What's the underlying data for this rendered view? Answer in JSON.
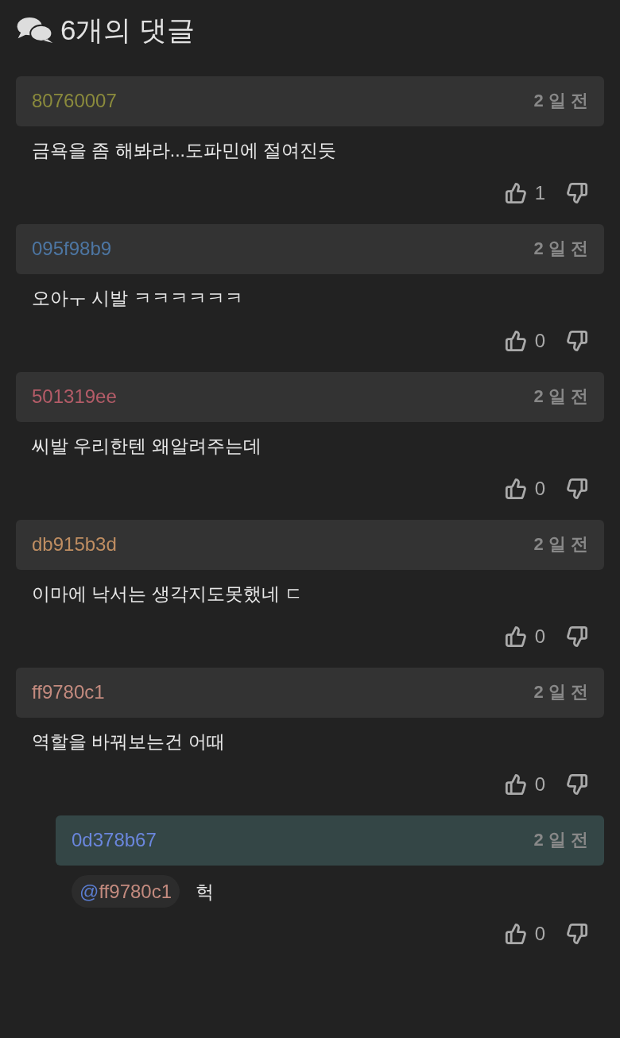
{
  "header": {
    "title": "6개의 댓글"
  },
  "comments": [
    {
      "author": "80760007",
      "color": "#8a8a3c",
      "time": "2 일 전",
      "text": "금욕을 좀 해봐라...도파민에 절여진듯",
      "likes": "1"
    },
    {
      "author": "095f98b9",
      "color": "#4d76a3",
      "time": "2 일 전",
      "text": "오아ㅜ 시발 ㅋㅋㅋㅋㅋㅋ",
      "likes": "0"
    },
    {
      "author": "501319ee",
      "color": "#b45c68",
      "time": "2 일 전",
      "text": "씨발 우리한텐 왜알려주는데",
      "likes": "0"
    },
    {
      "author": "db915b3d",
      "color": "#bf8e62",
      "time": "2 일 전",
      "text": "이마에 낙서는 생각지도못했네 ㄷ",
      "likes": "0"
    },
    {
      "author": "ff9780c1",
      "color": "#c48b7f",
      "time": "2 일 전",
      "text": "역할을 바꿔보는건 어때",
      "likes": "0",
      "replies": [
        {
          "author": "0d378b67",
          "color": "#6a86dc",
          "time": "2 일 전",
          "mention": {
            "prefix": "@",
            "user": "ff9780c1",
            "color": "#c48b7f"
          },
          "text": "헉",
          "likes": "0"
        }
      ]
    }
  ]
}
